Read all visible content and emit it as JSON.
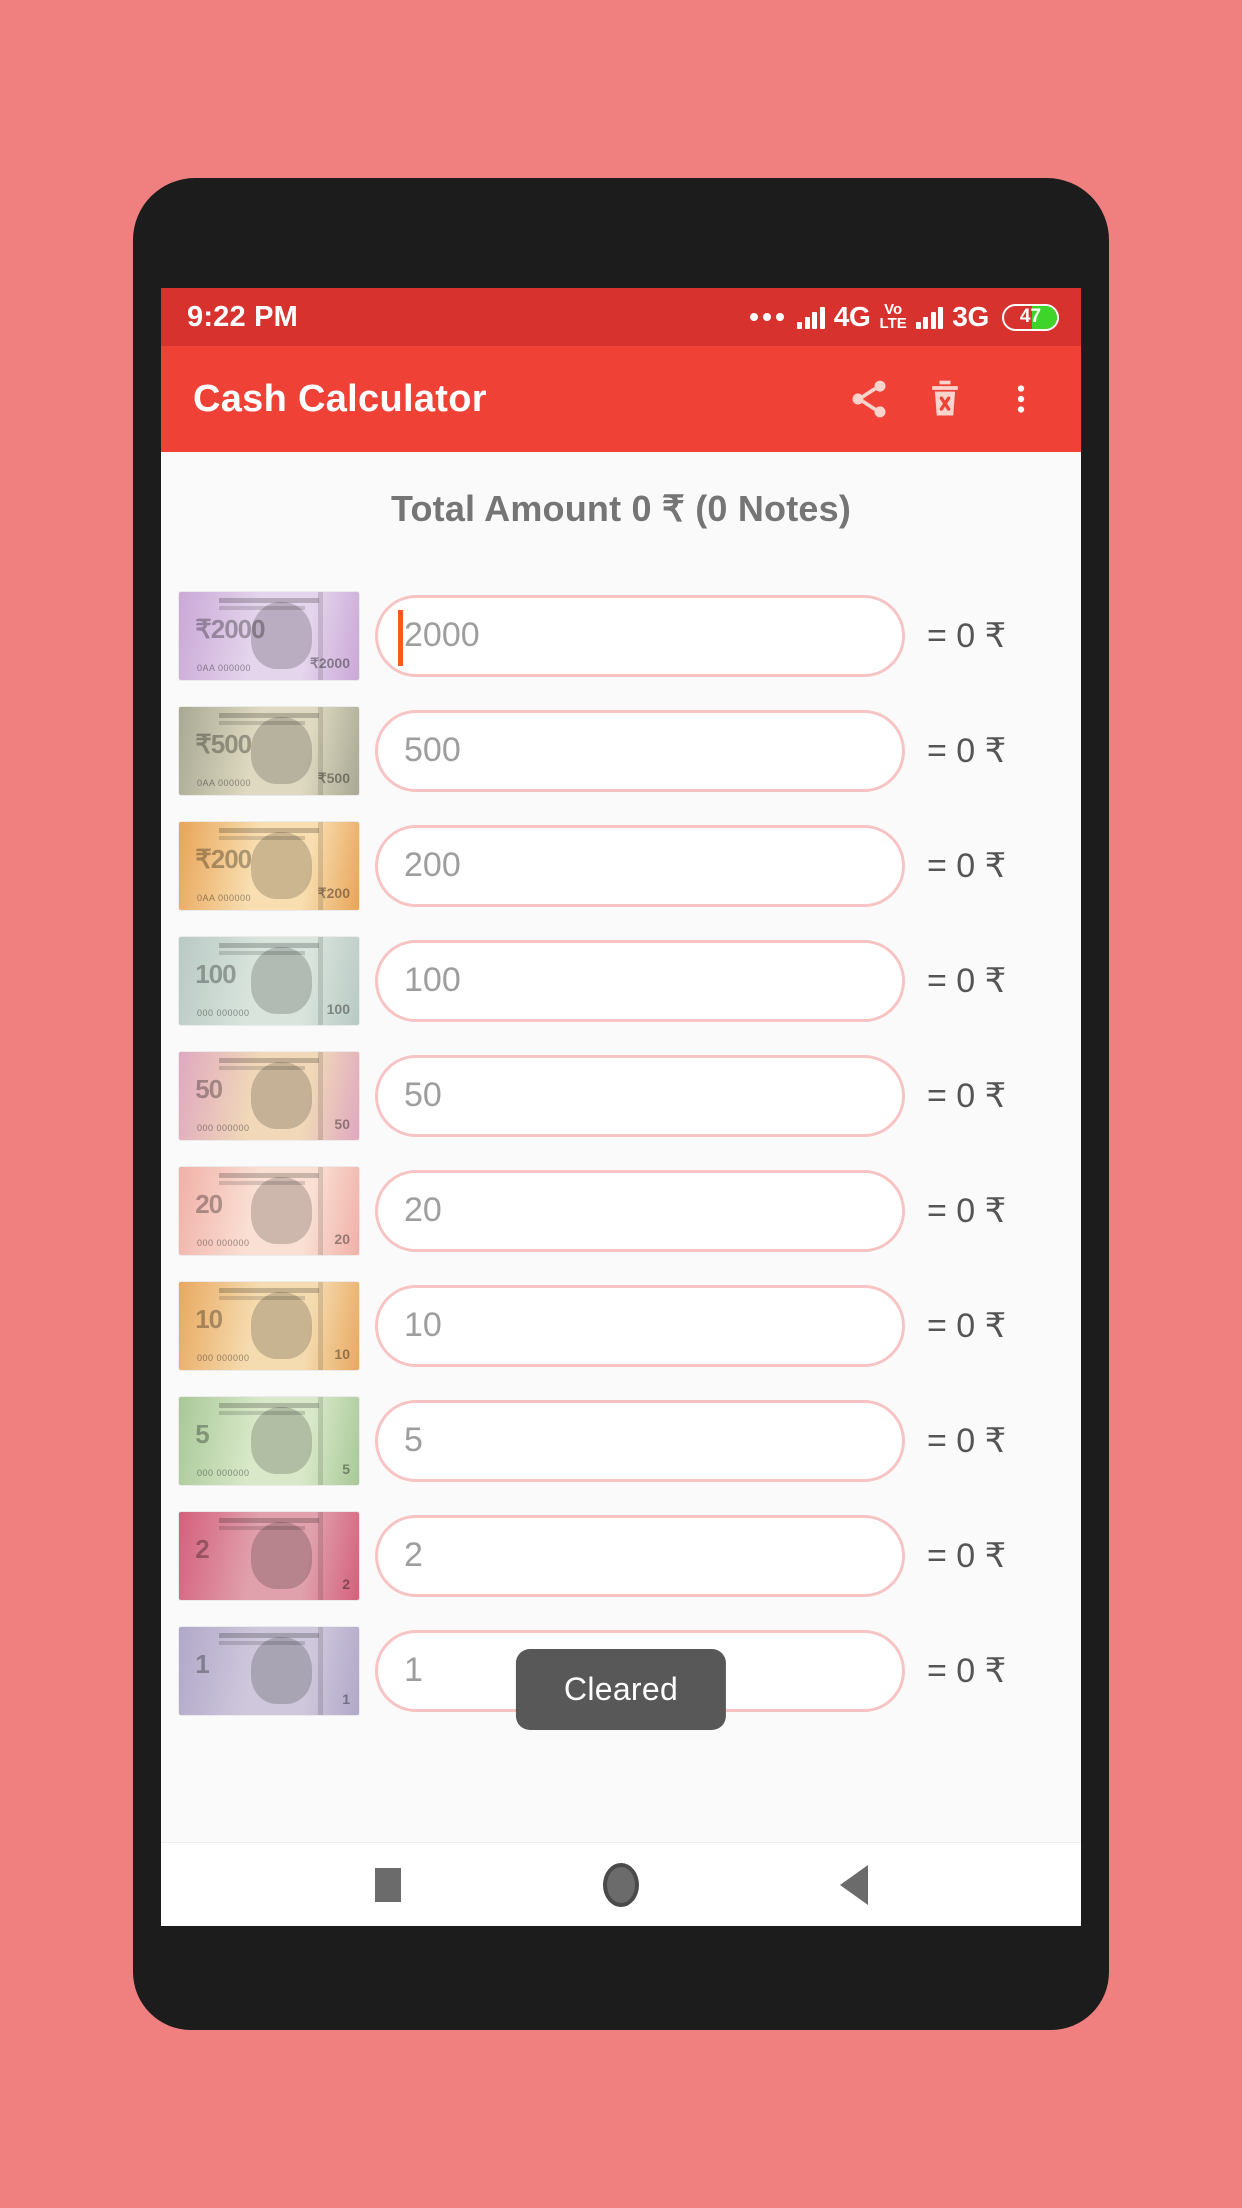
{
  "status_bar": {
    "time": "9:22 PM",
    "dots_icon": "more-dots-icon",
    "signal1_icon": "signal-bars-icon",
    "network1": "4G",
    "volte_top": "Vo",
    "volte_bottom": "LTE",
    "signal2_icon": "signal-bars-icon",
    "network2": "3G",
    "battery_level": "47",
    "bar_color": "#d8322e"
  },
  "app_bar": {
    "title": "Cash Calculator",
    "share_icon": "share-icon",
    "delete_icon": "delete-trash-icon",
    "overflow_icon": "overflow-menu-icon",
    "color": "#ef4136"
  },
  "content": {
    "total_amount": "Total Amount  0 ₹ (0 Notes)",
    "toast": "Cleared"
  },
  "notes": [
    {
      "denom": "2000",
      "placeholder": "2000",
      "result": "= 0 ₹",
      "focused": true,
      "note_color_left": "#c9a8d6",
      "note_color_right": "#e4d4ec",
      "serial": "0AA 000000",
      "face": "₹2000"
    },
    {
      "denom": "500",
      "placeholder": "500",
      "result": "= 0 ₹",
      "focused": false,
      "note_color_left": "#a8a894",
      "note_color_right": "#ded9c0",
      "serial": "0AA 000000",
      "face": "₹500"
    },
    {
      "denom": "200",
      "placeholder": "200",
      "result": "= 0 ₹",
      "focused": false,
      "note_color_left": "#e8a458",
      "note_color_right": "#f8deb0",
      "serial": "0AA 000000",
      "face": "₹200"
    },
    {
      "denom": "100",
      "placeholder": "100",
      "result": "= 0 ₹",
      "focused": false,
      "note_color_left": "#b9c9c4",
      "note_color_right": "#d8e4dc",
      "serial": "000 000000",
      "face": "100"
    },
    {
      "denom": "50",
      "placeholder": "50",
      "result": "= 0 ₹",
      "focused": false,
      "note_color_left": "#e0a8c0",
      "note_color_right": "#f0d8b8",
      "serial": "000 000000",
      "face": "50"
    },
    {
      "denom": "20",
      "placeholder": "20",
      "result": "= 0 ₹",
      "focused": false,
      "note_color_left": "#f0b0a8",
      "note_color_right": "#fae0d4",
      "serial": "000 000000",
      "face": "20"
    },
    {
      "denom": "10",
      "placeholder": "10",
      "result": "= 0 ₹",
      "focused": false,
      "note_color_left": "#e8a860",
      "note_color_right": "#f5dcb0",
      "serial": "000 000000",
      "face": "10"
    },
    {
      "denom": "5",
      "placeholder": "5",
      "result": "= 0 ₹",
      "focused": false,
      "note_color_left": "#a8c898",
      "note_color_right": "#d8e8c8",
      "serial": "000 000000",
      "face": "5"
    },
    {
      "denom": "2",
      "placeholder": "2",
      "result": "= 0 ₹",
      "focused": false,
      "note_color_left": "#d4607c",
      "note_color_right": "#e0a0ac",
      "serial": "",
      "face": "2"
    },
    {
      "denom": "1",
      "placeholder": "1",
      "result": "= 0 ₹",
      "focused": false,
      "note_color_left": "#b0a8c8",
      "note_color_right": "#cfc8dc",
      "serial": "",
      "face": "1"
    }
  ],
  "nav_bar": {
    "recents_icon": "recents-square-icon",
    "home_icon": "home-circle-icon",
    "back_icon": "back-triangle-icon"
  }
}
